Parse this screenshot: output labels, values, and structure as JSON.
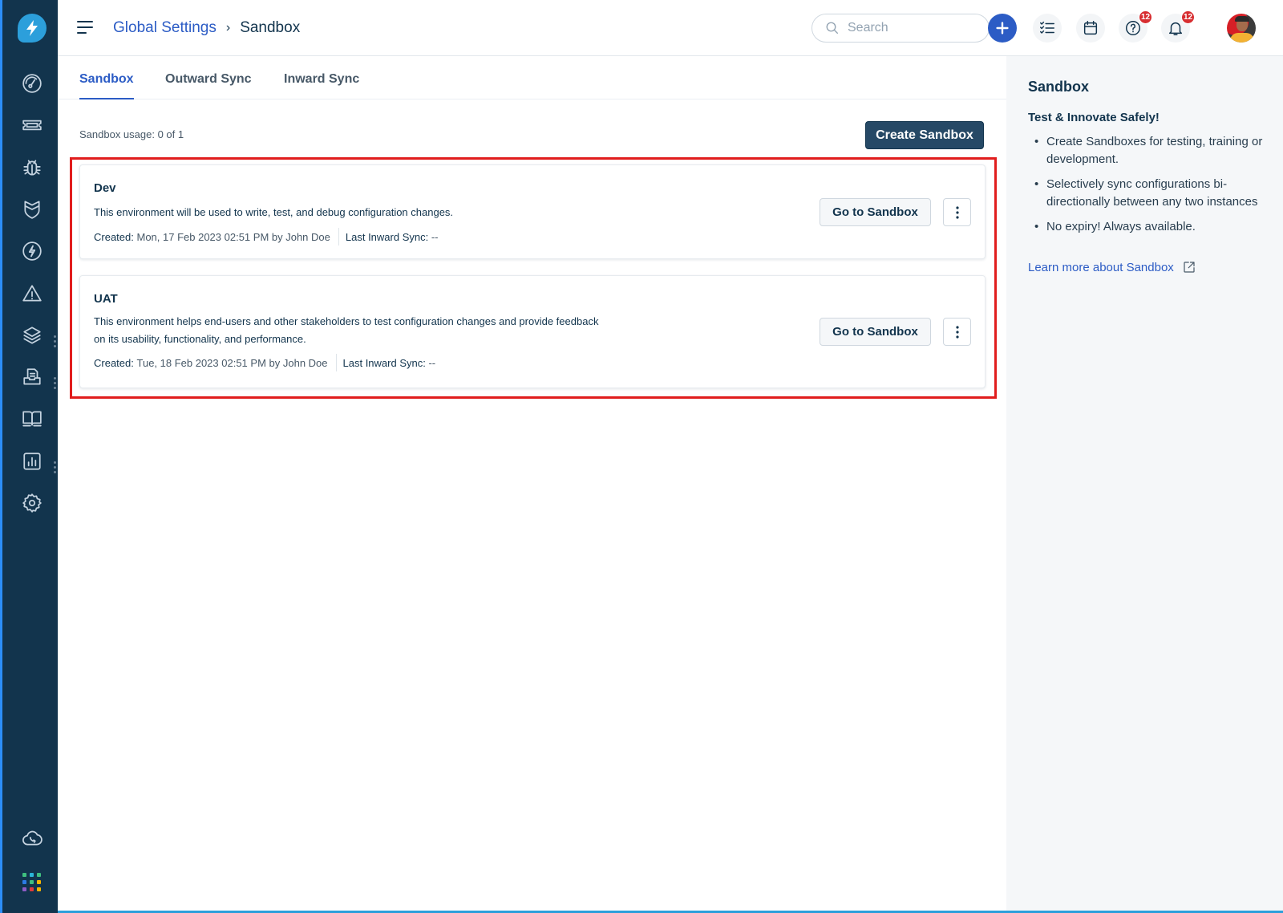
{
  "header": {
    "breadcrumb": {
      "parent": "Global Settings",
      "separator": "›",
      "current": "Sandbox"
    },
    "search": {
      "placeholder": "Search",
      "value": ""
    },
    "actions": {
      "help_badge": "12",
      "notifications_badge": "12"
    }
  },
  "rail": {
    "items": [
      {
        "icon": "dashboard-icon"
      },
      {
        "icon": "tickets-icon"
      },
      {
        "icon": "problems-bug-icon"
      },
      {
        "icon": "changes-shield-icon"
      },
      {
        "icon": "releases-bolt-icon"
      },
      {
        "icon": "alerts-warning-icon"
      },
      {
        "icon": "assets-layers-icon"
      },
      {
        "icon": "contracts-document-icon"
      },
      {
        "icon": "solutions-book-icon"
      },
      {
        "icon": "analytics-chart-icon"
      },
      {
        "icon": "admin-gear-icon"
      },
      {
        "icon": "cloud-phone-icon"
      },
      {
        "icon": "apps-grid-icon"
      }
    ],
    "app_colors": [
      "#3fbf7f",
      "#2bb5d8",
      "#3fbf7f",
      "#2c7be5",
      "#3fbf7f",
      "#f5b400",
      "#8e5cc5",
      "#e03b3b",
      "#f5b400"
    ]
  },
  "tabs": [
    {
      "label": "Sandbox",
      "active": true
    },
    {
      "label": "Outward Sync",
      "active": false
    },
    {
      "label": "Inward Sync",
      "active": false
    }
  ],
  "main": {
    "usage_text": "Sandbox usage: 0 of 1",
    "create_button": "Create Sandbox",
    "sandboxes": [
      {
        "name": "Dev",
        "description": "This environment will be used to write, test, and debug configuration changes.",
        "created_label": "Created:",
        "created_value": "Mon, 17 Feb 2023 02:51 PM by John Doe",
        "sync_label": "Last Inward Sync:",
        "sync_value": "--",
        "go_button": "Go to Sandbox"
      },
      {
        "name": "UAT",
        "description": "This environment helps end-users and other stakeholders to test configuration changes and provide feedback on its usability, functionality, and performance.",
        "created_label": "Created:",
        "created_value": "Tue, 18 Feb 2023 02:51 PM by John Doe",
        "sync_label": "Last Inward Sync:",
        "sync_value": "--",
        "go_button": "Go to Sandbox"
      }
    ]
  },
  "side_panel": {
    "title": "Sandbox",
    "subtitle": "Test & Innovate Safely!",
    "bullets": [
      "Create Sandboxes for testing, training or development.",
      "Selectively sync configurations bi-directionally between any two instances",
      "No expiry! Always available."
    ],
    "learn_more": "Learn more about Sandbox"
  },
  "colors": {
    "rail_bg": "#12344d",
    "accent": "#2c5cc5",
    "primary_button": "#264966",
    "badge": "#d72d30",
    "highlight_box": "#e11d1d"
  }
}
